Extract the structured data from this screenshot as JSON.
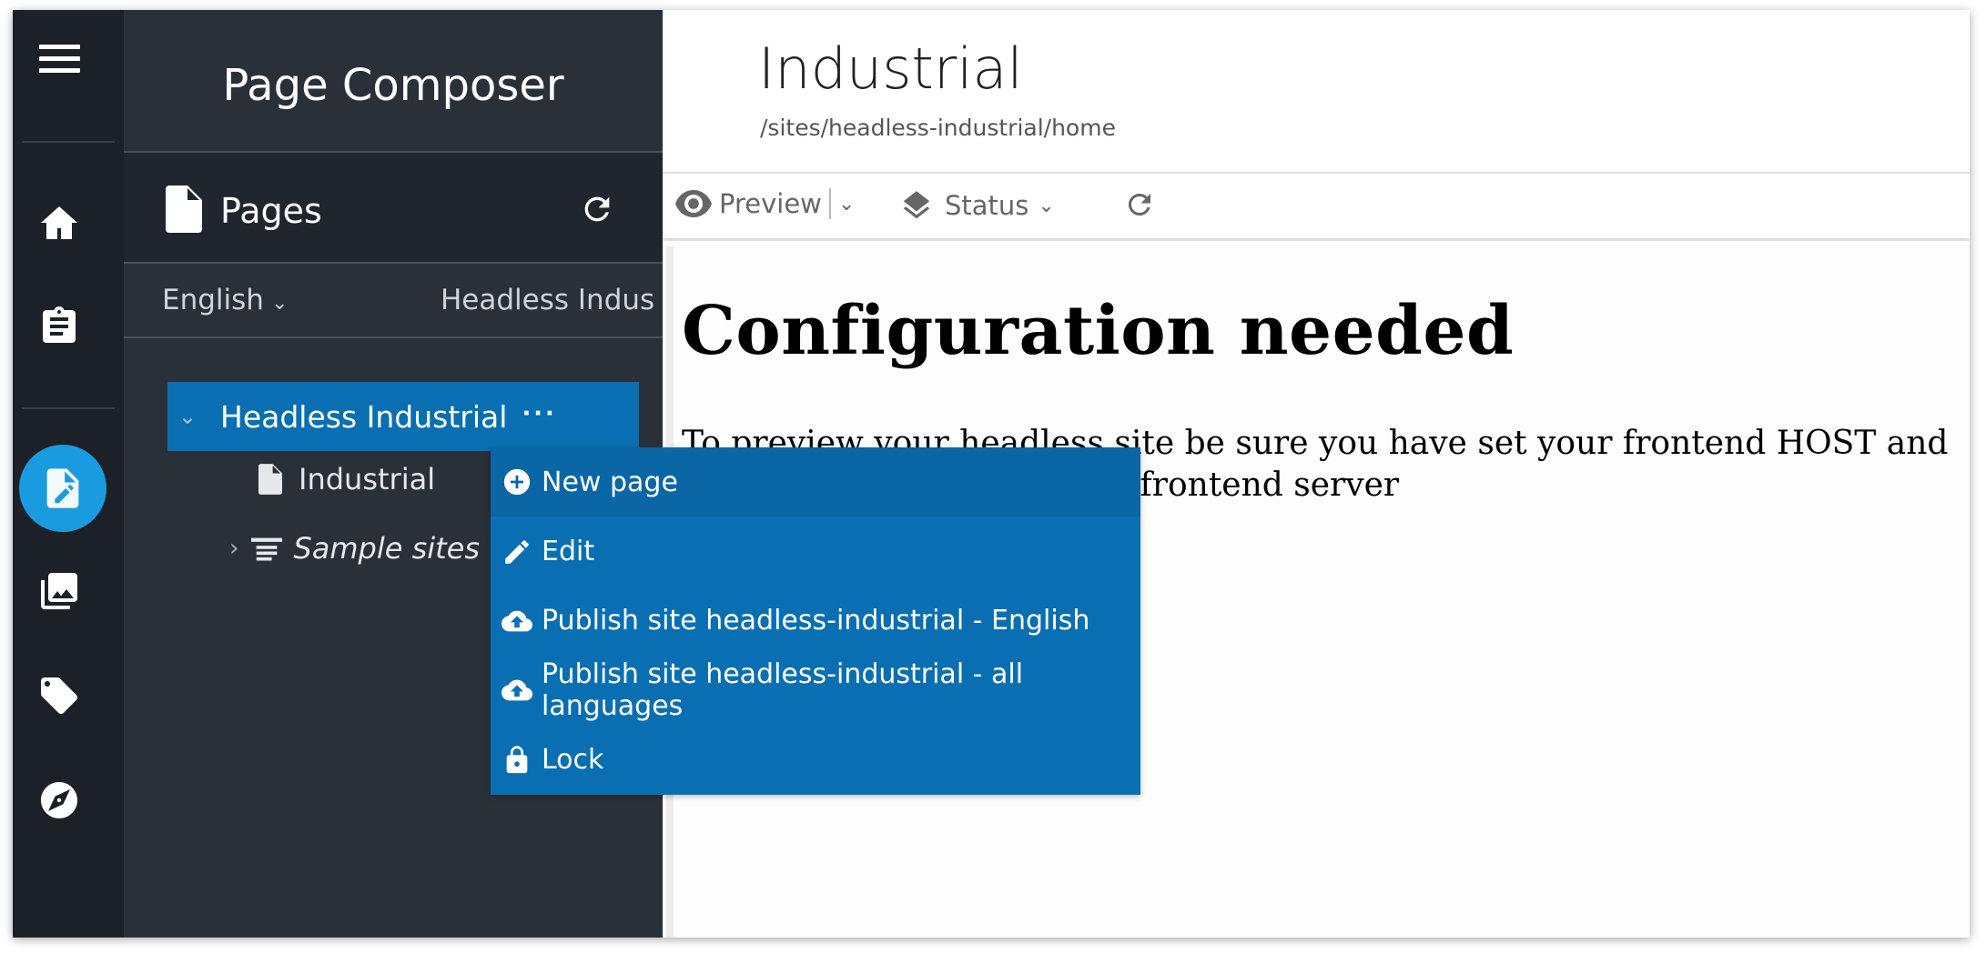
{
  "rail": {
    "icons": [
      "menu-icon",
      "home-icon",
      "clipboard-icon",
      "page-edit-icon",
      "images-icon",
      "tag-icon",
      "compass-icon"
    ]
  },
  "panel": {
    "title": "Page Composer",
    "pages_label": "Pages",
    "language": "English",
    "site": "Headless Indus",
    "tree": {
      "root_label": "Headless Industrial",
      "root_menu": "···",
      "items": [
        {
          "label": "Industrial"
        },
        {
          "label": "Sample sites"
        }
      ]
    }
  },
  "context_menu": {
    "items": [
      {
        "label": "New page",
        "icon": "plus-circle-icon"
      },
      {
        "label": "Edit",
        "icon": "pencil-icon"
      },
      {
        "label": "Publish site headless-industrial - English",
        "icon": "cloud-upload-icon"
      },
      {
        "label": "Publish site headless-industrial - all languages",
        "icon": "cloud-upload-icon"
      },
      {
        "label": "Lock",
        "icon": "lock-icon"
      }
    ]
  },
  "main": {
    "title": "Industrial",
    "path": "/sites/headless-industrial/home",
    "toolbar": {
      "preview_label": "Preview",
      "status_label": "Status"
    },
    "content": {
      "heading": "Configuration needed",
      "body": "To preview your headless site be sure you have set your frontend HOST and the ses secret to start your frontend server"
    }
  },
  "colors": {
    "rail_bg": "#1c2128",
    "panel_bg": "#2a3038",
    "accent_blue": "#0a6fb2",
    "active_icon_bg": "#1a9be0"
  }
}
